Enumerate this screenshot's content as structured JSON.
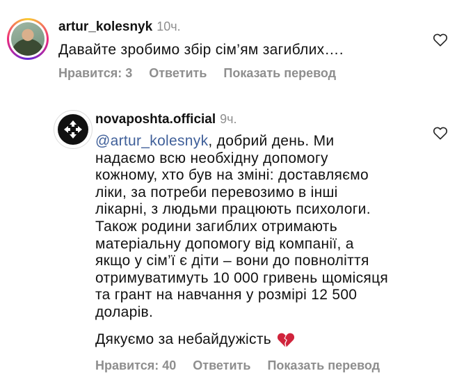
{
  "comments": [
    {
      "username": "artur_kolesnyk",
      "time": "10ч.",
      "text": "Давайте зробимо збір сім’ям загиблих….",
      "actions": {
        "likes": "Нравится: 3",
        "reply": "Ответить",
        "translate": "Показать перевод"
      }
    },
    {
      "username": "novaposhta.official",
      "time": "9ч.",
      "mention": "@artur_kolesnyk",
      "lines": [
        ", добрий день. Ми",
        "надаємо всю необхідну допомогу",
        "кожному, хто був на зміні: доставляємо",
        "ліки, за потреби перевозимо в інші",
        "лікарні, з людьми працюють психологи.",
        "Також родини загиблих отримають",
        "матеріальну допомогу від компанії, а",
        "якщо у сім’ї є діти – вони до повноліття",
        "отримуватимуть 10 000 гривень щомісяця",
        "та грант на навчання у розмірі 12 500",
        "доларів."
      ],
      "thanks": "Дякуємо за небайдужість",
      "emoji_icon": "broken-heart-icon",
      "actions": {
        "likes": "Нравится: 40",
        "reply": "Ответить",
        "translate": "Показать перевод"
      }
    }
  ],
  "colors": {
    "mention": "#3f5f99",
    "meta": "#8e8e8e",
    "heart_emoji": "#d0243c"
  }
}
